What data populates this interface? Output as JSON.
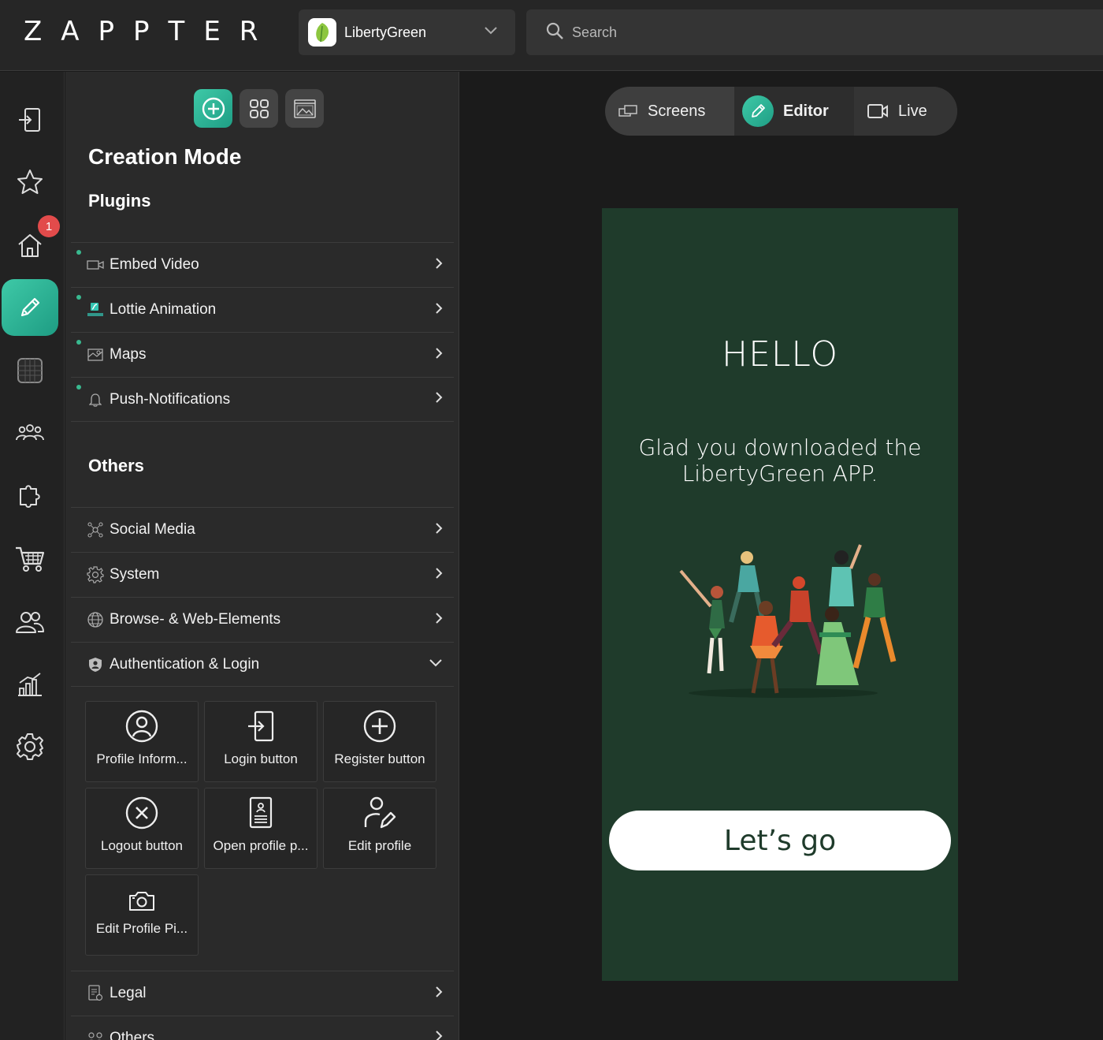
{
  "brand": {
    "logo_text": "ZAPPTER"
  },
  "app_selector": {
    "app_name": "LibertyGreen"
  },
  "search": {
    "placeholder": "Search"
  },
  "rail": {
    "notification_count": "1",
    "items": [
      "login-icon",
      "star-icon",
      "home-icon",
      "pencil-icon",
      "grid-icon",
      "team-icon",
      "puzzle-icon",
      "cart-icon",
      "users-icon",
      "chart-icon",
      "gear-icon"
    ],
    "active_item": "pencil-icon"
  },
  "panel": {
    "title": "Creation Mode",
    "plugins_heading": "Plugins",
    "plugins": [
      {
        "label": "Embed Video",
        "icon": "video-icon"
      },
      {
        "label": "Lottie Animation",
        "icon": "lottie-icon"
      },
      {
        "label": "Maps",
        "icon": "map-icon"
      },
      {
        "label": "Push-Notifications",
        "icon": "bell-icon"
      }
    ],
    "others_heading": "Others",
    "others": [
      {
        "label": "Social Media",
        "icon": "social-icon"
      },
      {
        "label": "System",
        "icon": "gear-icon"
      },
      {
        "label": "Browse- & Web-Elements",
        "icon": "globe-icon"
      },
      {
        "label": "Authentication & Login",
        "icon": "user-shield-icon",
        "expanded": true
      }
    ],
    "auth_tiles": [
      {
        "label": "Profile Inform...",
        "icon": "user-circle-icon"
      },
      {
        "label": "Login button",
        "icon": "login-icon"
      },
      {
        "label": "Register button",
        "icon": "plus-circle-icon"
      },
      {
        "label": "Logout button",
        "icon": "x-circle-icon"
      },
      {
        "label": "Open profile p...",
        "icon": "document-user-icon"
      },
      {
        "label": "Edit profile",
        "icon": "user-edit-icon"
      },
      {
        "label": "Edit Profile Pi...",
        "icon": "camera-icon"
      }
    ],
    "after": [
      {
        "label": "Legal",
        "icon": "legal-doc-icon"
      },
      {
        "label": "Others",
        "icon": "others-icon"
      }
    ]
  },
  "view_tabs": {
    "screens": "Screens",
    "editor": "Editor",
    "live": "Live",
    "active": "editor"
  },
  "preview": {
    "background": "#1f3b2b",
    "heading": "HELLO",
    "message": "Glad you downloaded the LibertyGreen APP.",
    "cta_label": "Let’s go"
  },
  "colors": {
    "accent": "#2fb597",
    "badge": "#e24b4b"
  }
}
